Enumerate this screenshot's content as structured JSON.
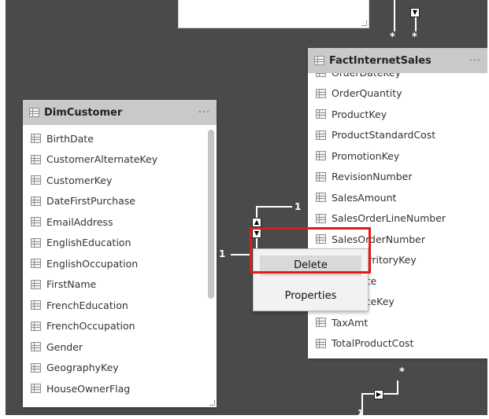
{
  "colors": {
    "canvas": "#4a4a4a",
    "header": "#c9c9c9",
    "highlight": "#e21a1a"
  },
  "dim_customer": {
    "title": "DimCustomer",
    "more": "···",
    "fields": [
      "BirthDate",
      "CustomerAlternateKey",
      "CustomerKey",
      "DateFirstPurchase",
      "EmailAddress",
      "EnglishEducation",
      "EnglishOccupation",
      "FirstName",
      "FrenchEducation",
      "FrenchOccupation",
      "Gender",
      "GeographyKey",
      "HouseOwnerFlag"
    ]
  },
  "fact_internet_sales": {
    "title": "FactInternetSales",
    "more": "···",
    "fields": [
      "OrderDateKey",
      "OrderQuantity",
      "ProductKey",
      "ProductStandardCost",
      "PromotionKey",
      "RevisionNumber",
      "SalesAmount",
      "SalesOrderLineNumber",
      "SalesOrderNumber",
      "SalesTerritoryKey",
      "ShipDate",
      "ShipDateKey",
      "TaxAmt",
      "TotalProductCost"
    ]
  },
  "relationship": {
    "cardinality_one_left": "1",
    "cardinality_one_right": "1",
    "cardinality_many": "*",
    "cardinality_one_bottom": "1"
  },
  "context_menu": {
    "delete_label": "Delete",
    "properties_label": "Properties"
  },
  "icons": {
    "table_icon": "table-grid-icon",
    "arrow_icon": "filter-direction-icon"
  }
}
